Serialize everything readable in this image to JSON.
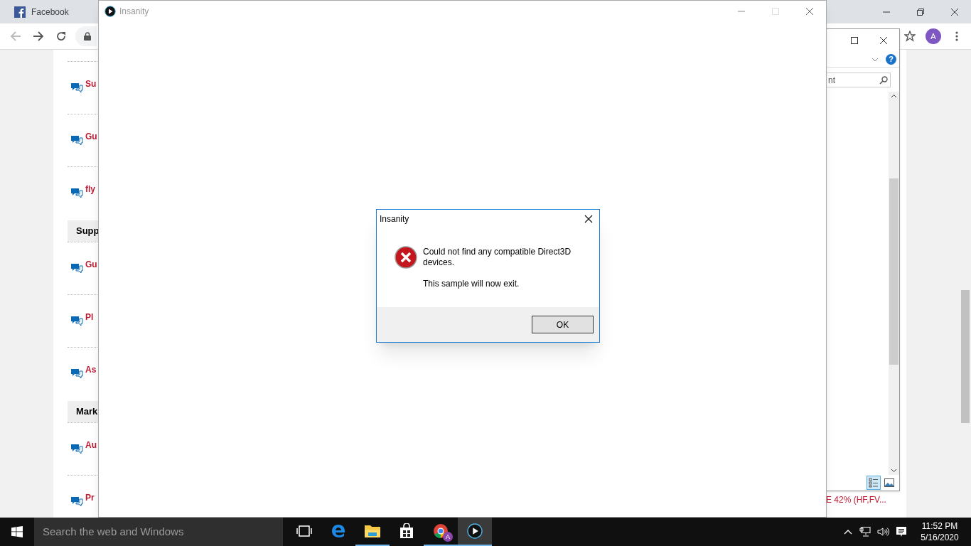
{
  "browser": {
    "tab": {
      "title": "Facebook"
    },
    "profile": {
      "initial": "A"
    },
    "page": {
      "list": [
        {
          "kind": "item",
          "text": "Su"
        },
        {
          "kind": "item",
          "text": "Gu"
        },
        {
          "kind": "item",
          "text": "fly"
        },
        {
          "kind": "section",
          "text": "Supp"
        },
        {
          "kind": "item",
          "text": "Gu"
        },
        {
          "kind": "item",
          "text": "Pl"
        },
        {
          "kind": "item",
          "text": "As"
        },
        {
          "kind": "section",
          "text": "Mark"
        },
        {
          "kind": "item",
          "text": "Au"
        },
        {
          "kind": "item",
          "text": "Pr"
        }
      ],
      "side_text": "E 42% (HF,FV..."
    }
  },
  "help_window": {
    "help_label": "?",
    "search": {
      "value": "nt"
    },
    "views": [
      {
        "selected": true
      },
      {
        "selected": false
      }
    ]
  },
  "app_window": {
    "title": "Insanity"
  },
  "dialog": {
    "title": "Insanity",
    "message": "Could not find any compatible Direct3D devices.",
    "note": "This sample will now exit.",
    "buttons": [
      "OK"
    ]
  },
  "taskbar": {
    "search": {
      "placeholder": "Search the web and Windows"
    },
    "apps": [
      {
        "kind": "taskview",
        "running": false,
        "selected": false
      },
      {
        "kind": "edge",
        "running": false,
        "selected": false
      },
      {
        "kind": "folder",
        "running": true,
        "selected": false
      },
      {
        "kind": "store",
        "running": false,
        "selected": false
      },
      {
        "kind": "chrome",
        "running": true,
        "selected": false,
        "badge": "A"
      },
      {
        "kind": "player",
        "running": true,
        "selected": true
      }
    ],
    "clock": {
      "time": "11:52 PM",
      "date": "5/16/2020"
    }
  }
}
